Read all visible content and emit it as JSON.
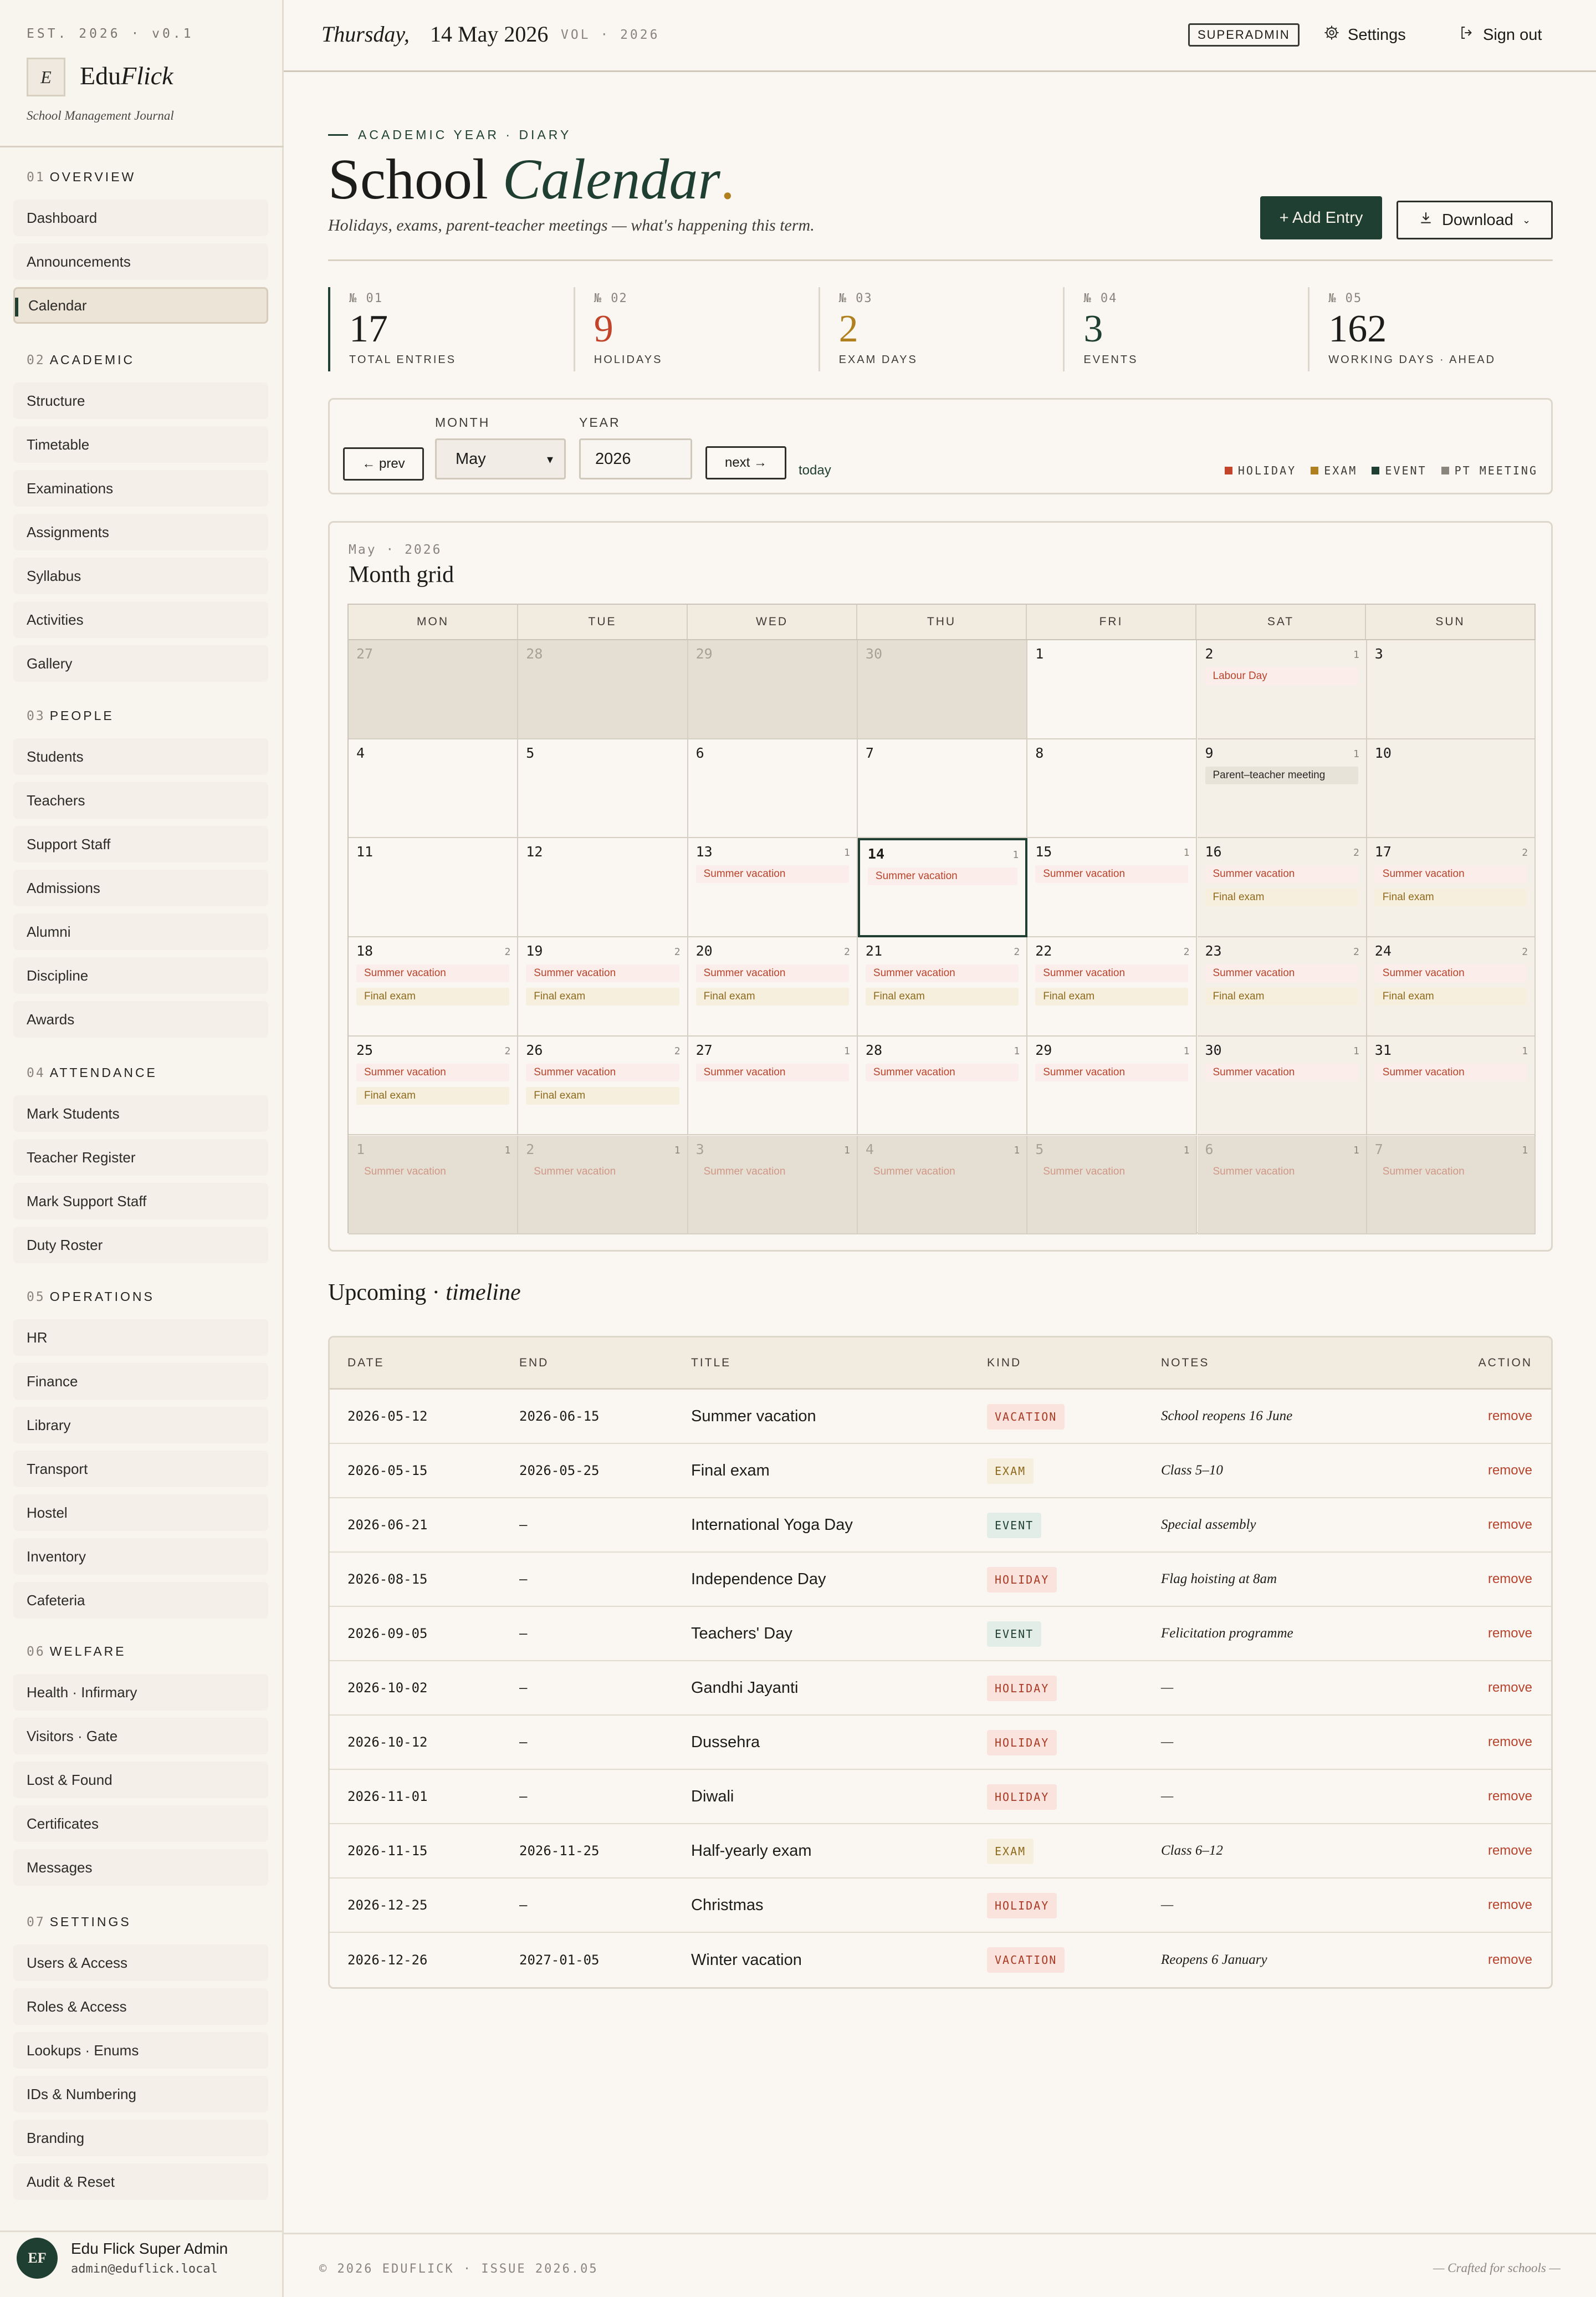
{
  "sidebar": {
    "est": "EST. 2026 · v0.1",
    "logo_mark": "E",
    "brand_a": "Edu",
    "brand_b": "Flick",
    "tagline": "School Management Journal",
    "sections": [
      {
        "num": "01",
        "title": "OVERVIEW",
        "items": [
          "Dashboard",
          "Announcements",
          "Calendar"
        ]
      },
      {
        "num": "02",
        "title": "ACADEMIC",
        "items": [
          "Structure",
          "Timetable",
          "Examinations",
          "Assignments",
          "Syllabus",
          "Activities",
          "Gallery"
        ]
      },
      {
        "num": "03",
        "title": "PEOPLE",
        "items": [
          "Students",
          "Teachers",
          "Support Staff",
          "Admissions",
          "Alumni",
          "Discipline",
          "Awards"
        ]
      },
      {
        "num": "04",
        "title": "ATTENDANCE",
        "items": [
          "Mark Students",
          "Teacher Register",
          "Mark Support Staff",
          "Duty Roster"
        ]
      },
      {
        "num": "05",
        "title": "OPERATIONS",
        "items": [
          "HR",
          "Finance",
          "Library",
          "Transport",
          "Hostel",
          "Inventory",
          "Cafeteria"
        ]
      },
      {
        "num": "06",
        "title": "WELFARE",
        "items": [
          "Health · Infirmary",
          "Visitors · Gate",
          "Lost & Found",
          "Certificates",
          "Messages"
        ]
      },
      {
        "num": "07",
        "title": "SETTINGS",
        "items": [
          "Users & Access",
          "Roles & Access",
          "Lookups · Enums",
          "IDs & Numbering",
          "Branding",
          "Audit & Reset"
        ]
      }
    ],
    "active": "Calendar",
    "user": {
      "initials": "EF",
      "name": "Edu Flick Super Admin",
      "email": "admin@eduflick.local"
    }
  },
  "topbar": {
    "day": "Thursday,",
    "date": "14 May 2026",
    "vol": "VOL · 2026",
    "role": "SUPERADMIN",
    "settings": "Settings",
    "signout": "Sign out"
  },
  "header": {
    "kicker": "ACADEMIC YEAR · DIARY",
    "title_a": "School",
    "title_b": "Calendar",
    "title_dot": ".",
    "subtitle": "Holidays, exams, parent-teacher meetings — what's happening this term.",
    "add_btn": "+ Add Entry",
    "download_btn": "Download"
  },
  "stats": [
    {
      "num": "№ 01",
      "value": "17",
      "label": "TOTAL ENTRIES",
      "color": "#1c1c1a"
    },
    {
      "num": "№ 02",
      "value": "9",
      "label": "HOLIDAYS",
      "color": "#c2442b"
    },
    {
      "num": "№ 03",
      "value": "2",
      "label": "EXAM DAYS",
      "color": "#b0801e"
    },
    {
      "num": "№ 04",
      "value": "3",
      "label": "EVENTS",
      "color": "#1f3f33"
    },
    {
      "num": "№ 05",
      "value": "162",
      "label": "WORKING DAYS · AHEAD",
      "color": "#1c1c1a"
    }
  ],
  "controls": {
    "prev": "← prev",
    "next": "next →",
    "today": "today",
    "month_label": "MONTH",
    "month": "May",
    "year_label": "YEAR",
    "year": "2026",
    "legend": [
      {
        "label": "HOLIDAY",
        "color": "#c2442b"
      },
      {
        "label": "EXAM",
        "color": "#b0801e"
      },
      {
        "label": "EVENT",
        "color": "#1f3f33"
      },
      {
        "label": "PT MEETING",
        "color": "#8a857c"
      }
    ]
  },
  "calendar": {
    "kicker": "May · 2026",
    "title": "Month grid",
    "weekdays": [
      "MON",
      "TUE",
      "WED",
      "THU",
      "FRI",
      "SAT",
      "SUN"
    ],
    "weeks": [
      [
        {
          "d": "27",
          "out": true,
          "ev": []
        },
        {
          "d": "28",
          "out": true,
          "ev": []
        },
        {
          "d": "29",
          "out": true,
          "ev": []
        },
        {
          "d": "30",
          "out": true,
          "ev": []
        },
        {
          "d": "1",
          "ev": []
        },
        {
          "d": "2",
          "cnt": "1",
          "ev": [
            {
              "t": "Labour Day",
              "k": "h"
            }
          ]
        },
        {
          "d": "3",
          "ev": []
        }
      ],
      [
        {
          "d": "4",
          "ev": []
        },
        {
          "d": "5",
          "ev": []
        },
        {
          "d": "6",
          "ev": []
        },
        {
          "d": "7",
          "ev": []
        },
        {
          "d": "8",
          "ev": []
        },
        {
          "d": "9",
          "cnt": "1",
          "ev": [
            {
              "t": "Parent–teacher meeting",
              "k": "p"
            }
          ]
        },
        {
          "d": "10",
          "ev": []
        }
      ],
      [
        {
          "d": "11",
          "ev": []
        },
        {
          "d": "12",
          "ev": []
        },
        {
          "d": "13",
          "cnt": "1",
          "ev": [
            {
              "t": "Summer vacation",
              "k": "h"
            }
          ]
        },
        {
          "d": "14",
          "cnt": "1",
          "today": true,
          "ev": [
            {
              "t": "Summer vacation",
              "k": "h"
            }
          ]
        },
        {
          "d": "15",
          "cnt": "1",
          "ev": [
            {
              "t": "Summer vacation",
              "k": "h"
            }
          ]
        },
        {
          "d": "16",
          "cnt": "2",
          "ev": [
            {
              "t": "Summer vacation",
              "k": "h"
            },
            {
              "t": "Final exam",
              "k": "x"
            }
          ]
        },
        {
          "d": "17",
          "cnt": "2",
          "ev": [
            {
              "t": "Summer vacation",
              "k": "h"
            },
            {
              "t": "Final exam",
              "k": "x"
            }
          ]
        }
      ],
      [
        {
          "d": "18",
          "cnt": "2",
          "ev": [
            {
              "t": "Summer vacation",
              "k": "h"
            },
            {
              "t": "Final exam",
              "k": "x"
            }
          ]
        },
        {
          "d": "19",
          "cnt": "2",
          "ev": [
            {
              "t": "Summer vacation",
              "k": "h"
            },
            {
              "t": "Final exam",
              "k": "x"
            }
          ]
        },
        {
          "d": "20",
          "cnt": "2",
          "ev": [
            {
              "t": "Summer vacation",
              "k": "h"
            },
            {
              "t": "Final exam",
              "k": "x"
            }
          ]
        },
        {
          "d": "21",
          "cnt": "2",
          "ev": [
            {
              "t": "Summer vacation",
              "k": "h"
            },
            {
              "t": "Final exam",
              "k": "x"
            }
          ]
        },
        {
          "d": "22",
          "cnt": "2",
          "ev": [
            {
              "t": "Summer vacation",
              "k": "h"
            },
            {
              "t": "Final exam",
              "k": "x"
            }
          ]
        },
        {
          "d": "23",
          "cnt": "2",
          "ev": [
            {
              "t": "Summer vacation",
              "k": "h"
            },
            {
              "t": "Final exam",
              "k": "x"
            }
          ]
        },
        {
          "d": "24",
          "cnt": "2",
          "ev": [
            {
              "t": "Summer vacation",
              "k": "h"
            },
            {
              "t": "Final exam",
              "k": "x"
            }
          ]
        }
      ],
      [
        {
          "d": "25",
          "cnt": "2",
          "ev": [
            {
              "t": "Summer vacation",
              "k": "h"
            },
            {
              "t": "Final exam",
              "k": "x"
            }
          ]
        },
        {
          "d": "26",
          "cnt": "2",
          "ev": [
            {
              "t": "Summer vacation",
              "k": "h"
            },
            {
              "t": "Final exam",
              "k": "x"
            }
          ]
        },
        {
          "d": "27",
          "cnt": "1",
          "ev": [
            {
              "t": "Summer vacation",
              "k": "h"
            }
          ]
        },
        {
          "d": "28",
          "cnt": "1",
          "ev": [
            {
              "t": "Summer vacation",
              "k": "h"
            }
          ]
        },
        {
          "d": "29",
          "cnt": "1",
          "ev": [
            {
              "t": "Summer vacation",
              "k": "h"
            }
          ]
        },
        {
          "d": "30",
          "cnt": "1",
          "ev": [
            {
              "t": "Summer vacation",
              "k": "h"
            }
          ]
        },
        {
          "d": "31",
          "cnt": "1",
          "ev": [
            {
              "t": "Summer vacation",
              "k": "h"
            }
          ]
        }
      ],
      [
        {
          "d": "1",
          "cnt": "1",
          "out": true,
          "ev": [
            {
              "t": "Summer vacation",
              "k": "h"
            }
          ]
        },
        {
          "d": "2",
          "cnt": "1",
          "out": true,
          "ev": [
            {
              "t": "Summer vacation",
              "k": "h"
            }
          ]
        },
        {
          "d": "3",
          "cnt": "1",
          "out": true,
          "ev": [
            {
              "t": "Summer vacation",
              "k": "h"
            }
          ]
        },
        {
          "d": "4",
          "cnt": "1",
          "out": true,
          "ev": [
            {
              "t": "Summer vacation",
              "k": "h"
            }
          ]
        },
        {
          "d": "5",
          "cnt": "1",
          "out": true,
          "ev": [
            {
              "t": "Summer vacation",
              "k": "h"
            }
          ]
        },
        {
          "d": "6",
          "cnt": "1",
          "out": true,
          "ev": [
            {
              "t": "Summer vacation",
              "k": "h"
            }
          ]
        },
        {
          "d": "7",
          "cnt": "1",
          "out": true,
          "ev": [
            {
              "t": "Summer vacation",
              "k": "h"
            }
          ]
        }
      ]
    ]
  },
  "upcoming": {
    "title_a": "Upcoming ·",
    "title_b": "timeline",
    "headers": [
      "DATE",
      "END",
      "TITLE",
      "KIND",
      "NOTES",
      "ACTION"
    ],
    "rows": [
      {
        "date": "2026-05-12",
        "end": "2026-06-15",
        "title": "Summer vacation",
        "kind": "VACATION",
        "notes": "School reopens 16 June",
        "action": "remove"
      },
      {
        "date": "2026-05-15",
        "end": "2026-05-25",
        "title": "Final exam",
        "kind": "EXAM",
        "notes": "Class 5–10",
        "action": "remove"
      },
      {
        "date": "2026-06-21",
        "end": "–",
        "title": "International Yoga Day",
        "kind": "EVENT",
        "notes": "Special assembly",
        "action": "remove"
      },
      {
        "date": "2026-08-15",
        "end": "–",
        "title": "Independence Day",
        "kind": "HOLIDAY",
        "notes": "Flag hoisting at 8am",
        "action": "remove"
      },
      {
        "date": "2026-09-05",
        "end": "–",
        "title": "Teachers' Day",
        "kind": "EVENT",
        "notes": "Felicitation programme",
        "action": "remove"
      },
      {
        "date": "2026-10-02",
        "end": "–",
        "title": "Gandhi Jayanti",
        "kind": "HOLIDAY",
        "notes": "—",
        "action": "remove"
      },
      {
        "date": "2026-10-12",
        "end": "–",
        "title": "Dussehra",
        "kind": "HOLIDAY",
        "notes": "—",
        "action": "remove"
      },
      {
        "date": "2026-11-01",
        "end": "–",
        "title": "Diwali",
        "kind": "HOLIDAY",
        "notes": "—",
        "action": "remove"
      },
      {
        "date": "2026-11-15",
        "end": "2026-11-25",
        "title": "Half-yearly exam",
        "kind": "EXAM",
        "notes": "Class 6–12",
        "action": "remove"
      },
      {
        "date": "2026-12-25",
        "end": "–",
        "title": "Christmas",
        "kind": "HOLIDAY",
        "notes": "—",
        "action": "remove"
      },
      {
        "date": "2026-12-26",
        "end": "2027-01-05",
        "title": "Winter vacation",
        "kind": "VACATION",
        "notes": "Reopens 6 January",
        "action": "remove"
      }
    ]
  },
  "footer": {
    "left": "© 2026 EDUFLICK · ISSUE 2026.05",
    "right": "— Crafted for schools —"
  }
}
